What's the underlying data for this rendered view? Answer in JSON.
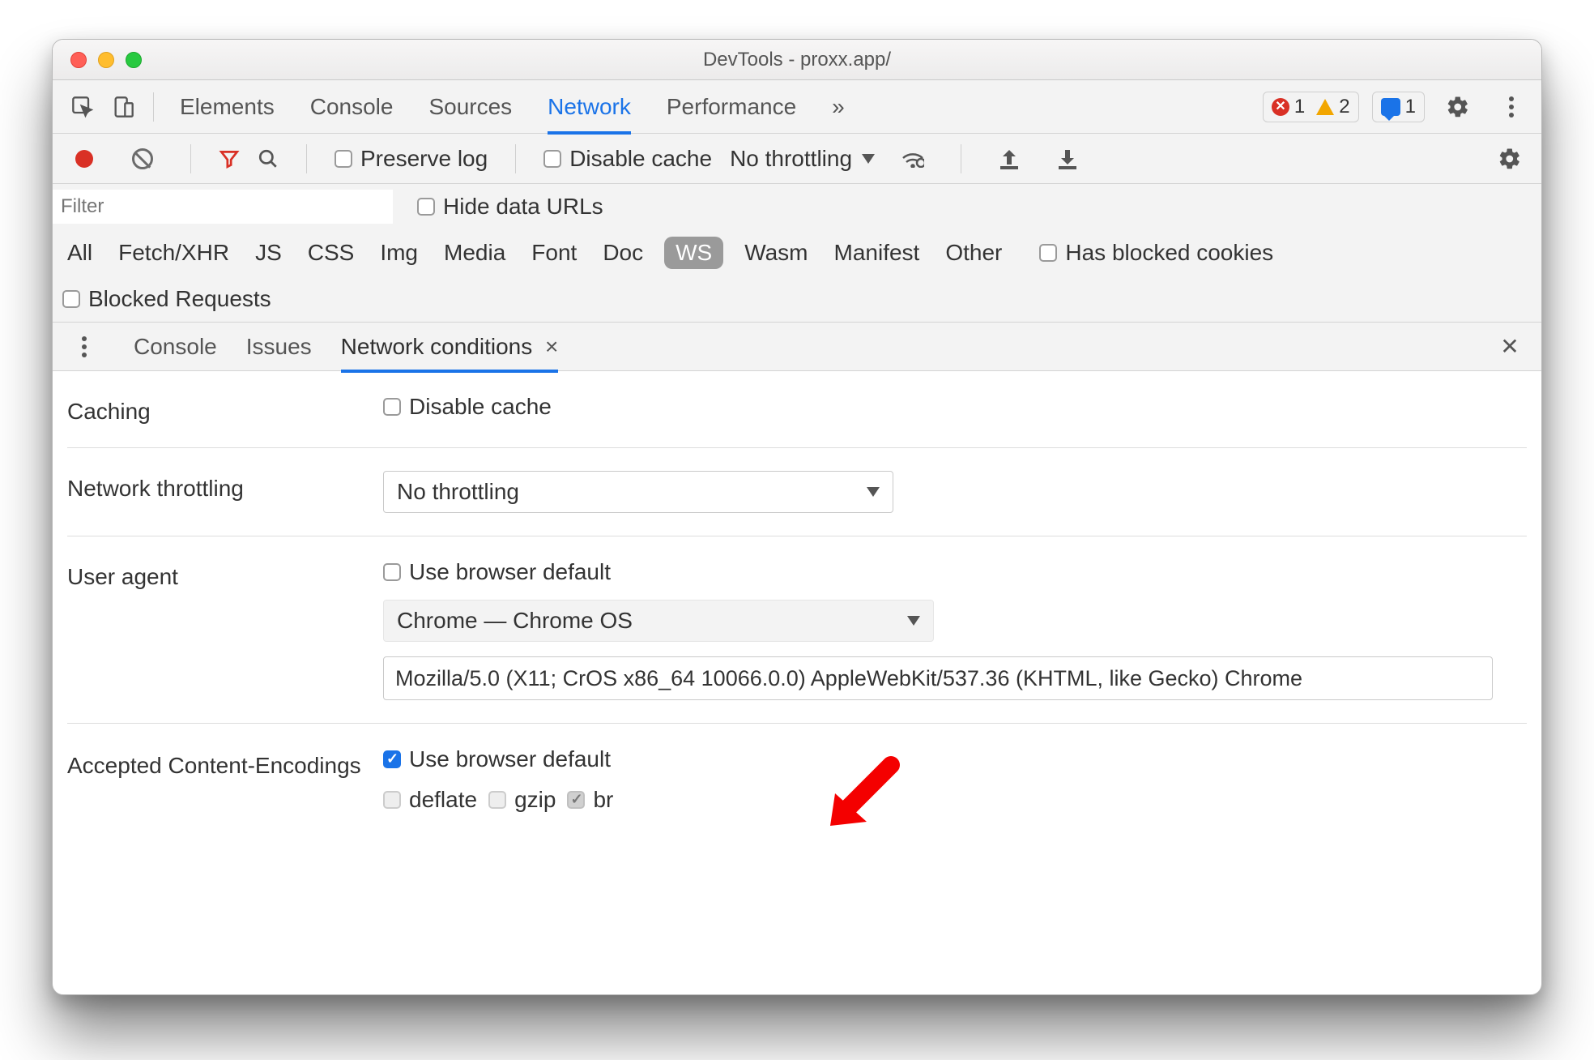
{
  "window": {
    "title": "DevTools - proxx.app/"
  },
  "maintabs": {
    "elements": "Elements",
    "console": "Console",
    "sources": "Sources",
    "network": "Network",
    "performance": "Performance"
  },
  "statusbar": {
    "errors": "1",
    "warnings": "2",
    "messages": "1"
  },
  "nettoolbar": {
    "preserve_log": "Preserve log",
    "disable_cache": "Disable cache",
    "throttling": "No throttling"
  },
  "filter": {
    "placeholder": "Filter",
    "hide_data_urls": "Hide data URLs",
    "types": {
      "all": "All",
      "fetch": "Fetch/XHR",
      "js": "JS",
      "css": "CSS",
      "img": "Img",
      "media": "Media",
      "font": "Font",
      "doc": "Doc",
      "ws": "WS",
      "wasm": "Wasm",
      "manifest": "Manifest",
      "other": "Other"
    },
    "blocked_cookies": "Has blocked cookies",
    "blocked_requests": "Blocked Requests"
  },
  "drawer": {
    "console": "Console",
    "issues": "Issues",
    "netcond": "Network conditions"
  },
  "netcond": {
    "caching_label": "Caching",
    "caching_disable": "Disable cache",
    "throttle_label": "Network throttling",
    "throttle_value": "No throttling",
    "ua_label": "User agent",
    "ua_default": "Use browser default",
    "ua_select": "Chrome — Chrome OS",
    "ua_string": "Mozilla/5.0 (X11; CrOS x86_64 10066.0.0) AppleWebKit/537.36 (KHTML, like Gecko) Chrome",
    "enc_label": "Accepted Content-Encodings",
    "enc_default": "Use browser default",
    "enc_deflate": "deflate",
    "enc_gzip": "gzip",
    "enc_br": "br"
  }
}
